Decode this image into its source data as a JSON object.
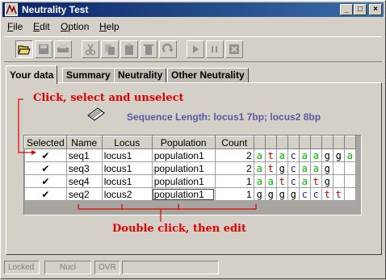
{
  "window": {
    "title": "Neutrality Test"
  },
  "menu": [
    {
      "label": "File",
      "key": "F",
      "rest": "ile"
    },
    {
      "label": "Edit",
      "key": "E",
      "rest": "dit"
    },
    {
      "label": "Option",
      "key": "O",
      "rest": "ption"
    },
    {
      "label": "Help",
      "key": "H",
      "rest": "elp"
    }
  ],
  "toolbar": [
    "open-icon",
    "save-icon",
    "print-icon",
    "cut-icon",
    "copy-icon",
    "paste-icon",
    "delete-icon",
    "redo-icon",
    "play-icon",
    "pause-icon",
    "stop-icon"
  ],
  "tabs": [
    "Your data",
    "Summary",
    "Neutrality",
    "Other Neutrality"
  ],
  "annotations": {
    "top": "Click, select and unselect",
    "bottom": "Double click, then edit"
  },
  "sequence_length": "Sequence Length:  locus1 7bp; locus2 8bp",
  "table": {
    "headers": [
      "Selected",
      "Name",
      "Locus",
      "Population",
      "Count"
    ],
    "rows": [
      {
        "selected": true,
        "name": "seq1",
        "locus": "locus1",
        "population": "population1",
        "count": "2",
        "bases": [
          "a",
          "t",
          "a",
          "c",
          "a",
          "a",
          "g",
          "g",
          "a"
        ]
      },
      {
        "selected": true,
        "name": "seq3",
        "locus": "locus1",
        "population": "population1",
        "count": "2",
        "bases": [
          "a",
          "t",
          "g",
          "c",
          "a",
          "a",
          "g",
          ""
        ]
      },
      {
        "selected": true,
        "name": "seq4",
        "locus": "locus1",
        "population": "population1",
        "count": "1",
        "bases": [
          "a",
          "a",
          "t",
          "c",
          "a",
          "t",
          "g",
          ""
        ]
      },
      {
        "selected": true,
        "name": "seq2",
        "locus": "locus2",
        "population": "population1",
        "count": "1",
        "bases": [
          "g",
          "g",
          "g",
          "g",
          "c",
          "c",
          "t",
          "t"
        ]
      }
    ]
  },
  "colors": {
    "a": "#00b000",
    "t": "#d00000",
    "g": "#000000",
    "c": "#2020d0",
    "annotation": "#e00000",
    "sequence_length": "#5a5aa0"
  },
  "status": [
    "Locked",
    "Nucl",
    "OVR",
    ""
  ]
}
